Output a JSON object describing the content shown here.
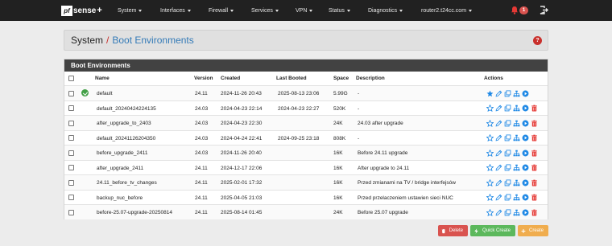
{
  "navbar": {
    "brand_prefix": "pf",
    "brand_name": "sense",
    "brand_plus": "+",
    "menu": [
      "System",
      "Interfaces",
      "Firewall",
      "Services",
      "VPN",
      "Status",
      "Diagnostics",
      "router2.t24cc.com"
    ],
    "notification_count": "1"
  },
  "breadcrumb": {
    "parent": "System",
    "separator": "/",
    "current": "Boot Environments"
  },
  "panel": {
    "title": "Boot Environments",
    "columns": {
      "name": "Name",
      "version": "Version",
      "created": "Created",
      "last_booted": "Last Booted",
      "space": "Space",
      "description": "Description",
      "actions": "Actions"
    },
    "rows": [
      {
        "name": "default",
        "version": "24.11",
        "created": "2024-11-26 20:43",
        "last_booted": "2025-08-13 23:06",
        "space": "5.99G",
        "description": "-",
        "active": true
      },
      {
        "name": "default_20240424224135",
        "version": "24.03",
        "created": "2024-04-23 22:14",
        "last_booted": "2024-04-23 22:27",
        "space": "520K",
        "description": "-",
        "active": false
      },
      {
        "name": "after_upgrade_to_2403",
        "version": "24.03",
        "created": "2024-04-23 22:30",
        "last_booted": "",
        "space": "24K",
        "description": "24.03 after upgrade",
        "active": false
      },
      {
        "name": "default_20241126204350",
        "version": "24.03",
        "created": "2024-04-24 22:41",
        "last_booted": "2024-09-25 23:18",
        "space": "808K",
        "description": "-",
        "active": false
      },
      {
        "name": "before_upgrade_2411",
        "version": "24.03",
        "created": "2024-11-26 20:40",
        "last_booted": "",
        "space": "16K",
        "description": "Before 24.11 upgrade",
        "active": false
      },
      {
        "name": "after_upgrade_2411",
        "version": "24.11",
        "created": "2024-12-17 22:06",
        "last_booted": "",
        "space": "16K",
        "description": "After upgrade to 24.11",
        "active": false
      },
      {
        "name": "24.11_before_tv_changes",
        "version": "24.11",
        "created": "2025-02-01 17:32",
        "last_booted": "",
        "space": "16K",
        "description": "Przed zmianami na TV / bridge interfejsów",
        "active": false
      },
      {
        "name": "backup_nuc_before",
        "version": "24.11",
        "created": "2025-04-05 21:03",
        "last_booted": "",
        "space": "16K",
        "description": "Przed przelaczeniem ustawien sieci NUC",
        "active": false
      },
      {
        "name": "before-25.07-upgrade-20250814",
        "version": "24.11",
        "created": "2025-08-14 01:45",
        "last_booted": "",
        "space": "24K",
        "description": "Before 25.07 upgrade",
        "active": false
      }
    ]
  },
  "buttons": {
    "delete": "Delete",
    "quick_create": "Quick Create",
    "create": "Create"
  },
  "colors": {
    "navbar": "#212121",
    "accent_red": "#d9534f",
    "link_blue": "#337ab7",
    "action_blue": "#1e88e5",
    "success": "#5cb85c",
    "warning": "#f0ad4e"
  },
  "icons": {
    "row_actions": [
      "star-icon",
      "pencil-icon",
      "copy-icon",
      "sitemap-icon",
      "play-icon",
      "trash-icon"
    ],
    "active_row_actions": [
      "star-icon",
      "pencil-icon",
      "copy-icon",
      "sitemap-icon",
      "play-icon"
    ]
  }
}
